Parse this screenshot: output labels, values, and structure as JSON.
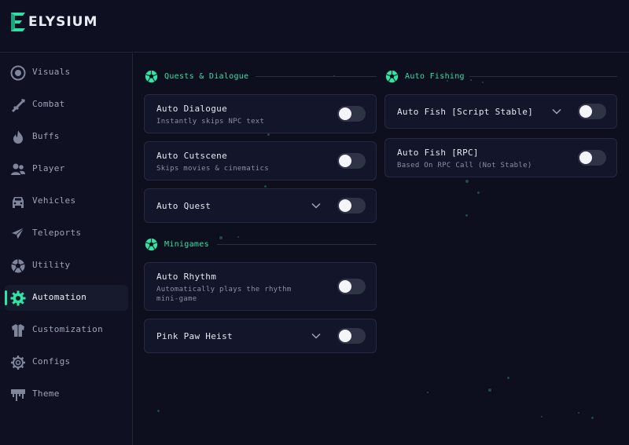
{
  "app": {
    "name": "ELYSIUM"
  },
  "sidebar": {
    "items": [
      {
        "label": "Visuals",
        "icon": "eye-icon"
      },
      {
        "label": "Combat",
        "icon": "rifle-icon"
      },
      {
        "label": "Buffs",
        "icon": "flame-icon"
      },
      {
        "label": "Player",
        "icon": "users-icon"
      },
      {
        "label": "Vehicles",
        "icon": "car-icon"
      },
      {
        "label": "Teleports",
        "icon": "paper-plane-icon"
      },
      {
        "label": "Utility",
        "icon": "soccer-ball-icon"
      },
      {
        "label": "Automation",
        "icon": "gear-icon"
      },
      {
        "label": "Customization",
        "icon": "shirt-icon"
      },
      {
        "label": "Configs",
        "icon": "cog-icon"
      },
      {
        "label": "Theme",
        "icon": "paint-drip-icon"
      }
    ],
    "active": "Automation"
  },
  "sections": {
    "quests": {
      "title": "Quests & Dialogue",
      "cards": [
        {
          "title": "Auto Dialogue",
          "desc": "Instantly skips NPC text",
          "enabled": false
        },
        {
          "title": "Auto Cutscene",
          "desc": "Skips movies & cinematics",
          "enabled": false
        },
        {
          "title": "Auto Quest",
          "enabled": false,
          "expandable": true
        }
      ]
    },
    "minigames": {
      "title": "Minigames",
      "cards": [
        {
          "title": "Auto Rhythm",
          "desc_line1": "Automatically plays the rhythm",
          "desc_line2": "mini-game",
          "enabled": false
        },
        {
          "title": "Pink Paw Heist",
          "enabled": false,
          "expandable": true
        }
      ]
    },
    "fishing": {
      "title": "Auto Fishing",
      "cards": [
        {
          "title": "Auto Fish [Script Stable]",
          "enabled": false,
          "expandable": true
        },
        {
          "title": "Auto Fish [RPC]",
          "desc": "Based On RPC Call (Not Stable)",
          "enabled": false
        }
      ]
    }
  },
  "colors": {
    "accent": "#2ee6a4",
    "background": "#0d0e1e",
    "card": "#13152a",
    "toggle_off": "#2f3346"
  }
}
